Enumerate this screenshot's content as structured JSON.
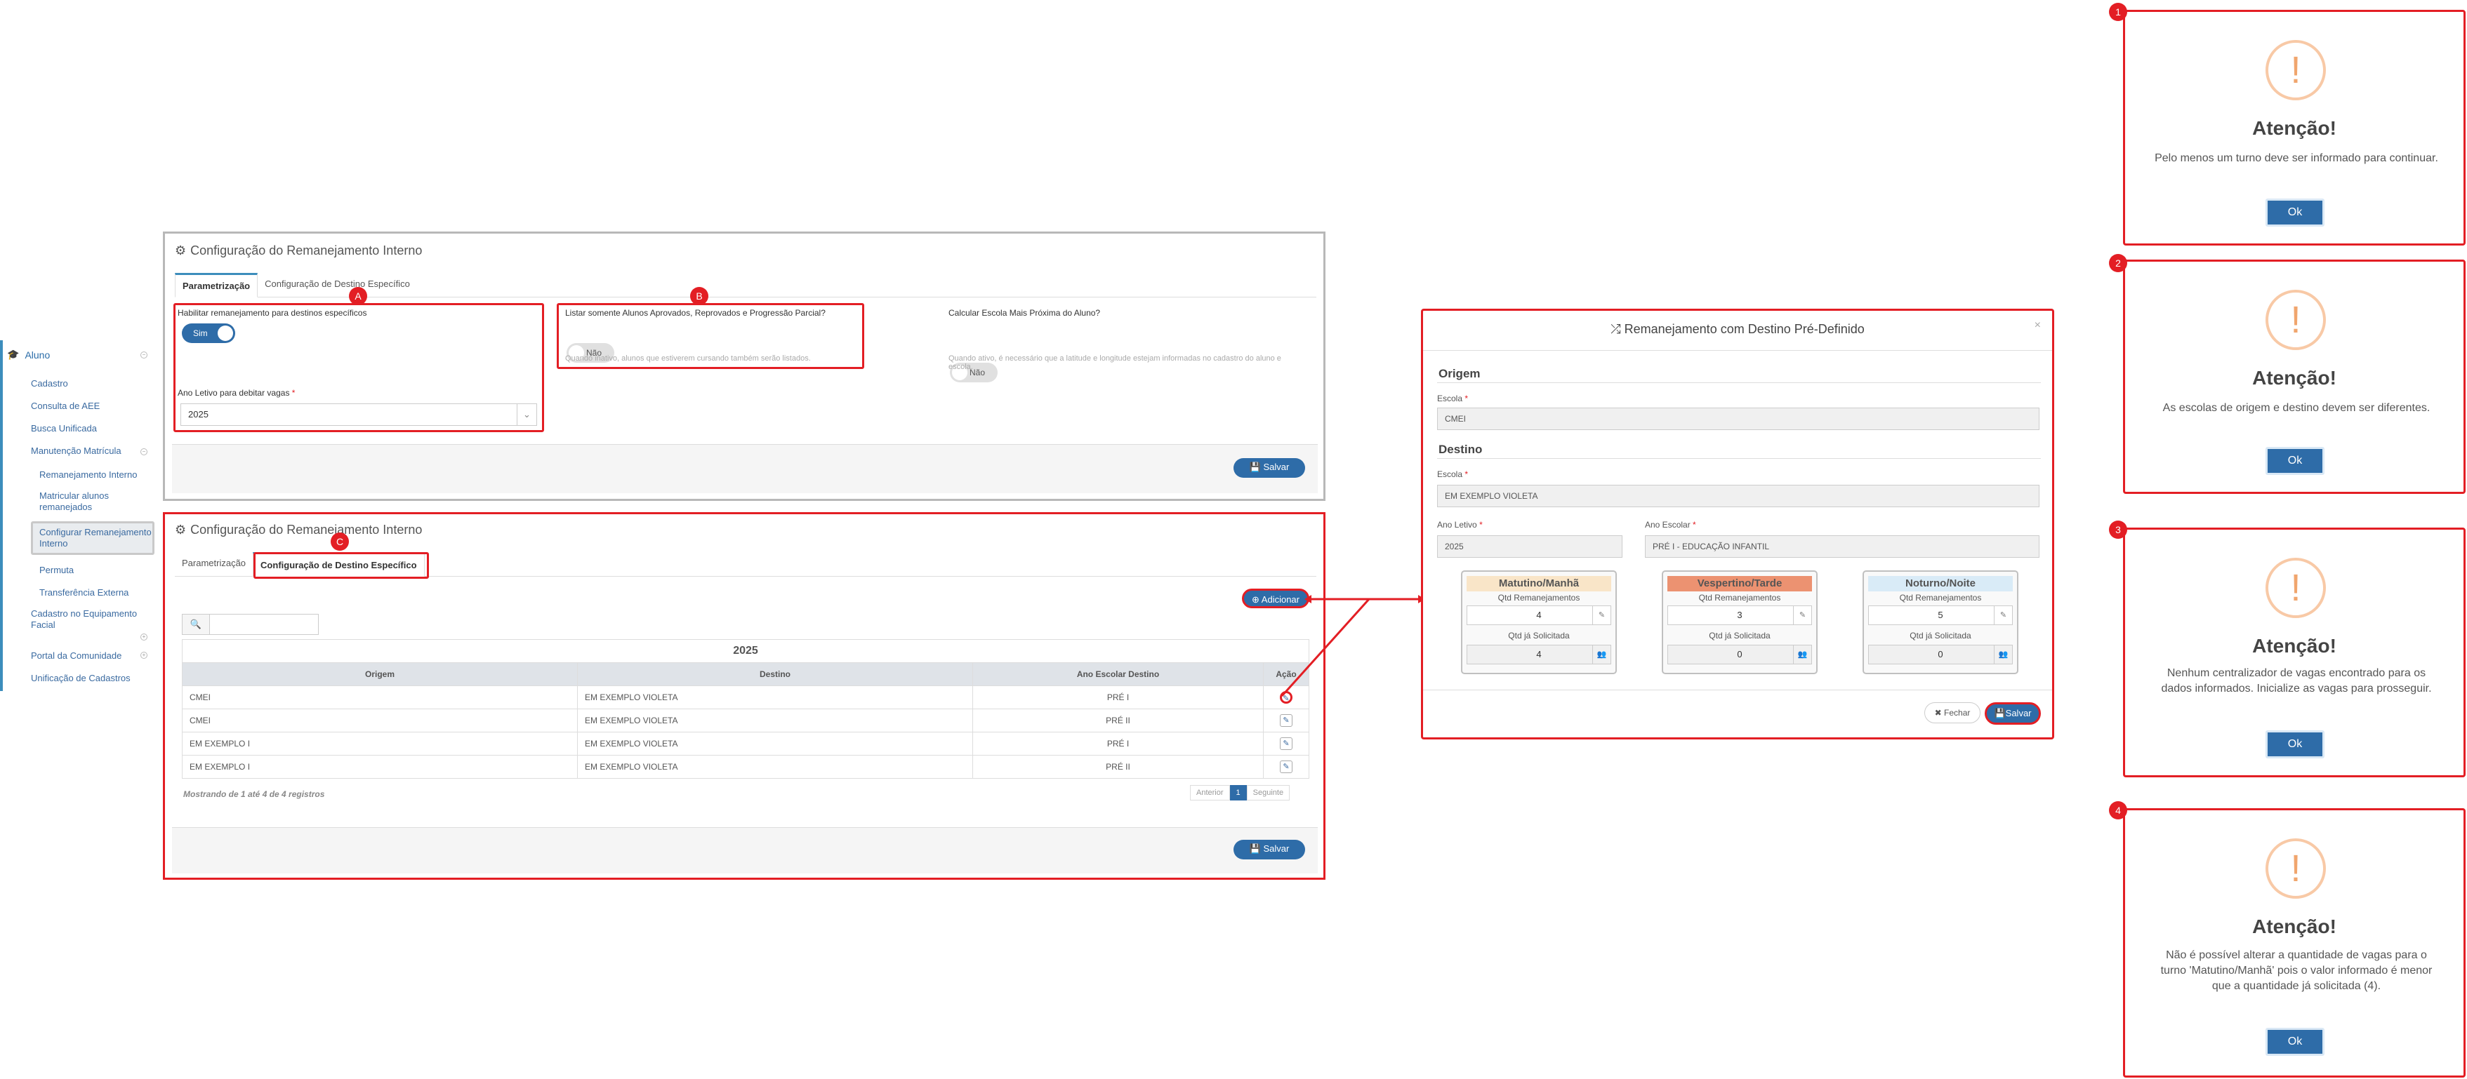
{
  "sidebar": {
    "header": "Aluno",
    "items": [
      "Cadastro",
      "Consulta de AEE",
      "Busca Unificada",
      "Manutenção Matrícula"
    ],
    "sub": [
      "Remanejamento Interno",
      "Matricular alunos remanejados",
      "Configurar Remanejamento Interno",
      "Permuta",
      "Transferência Externa"
    ],
    "items2": [
      "Cadastro no Equipamento Facial",
      "Portal da Comunidade",
      "Unificação de Cadastros"
    ]
  },
  "panel1": {
    "title": "Configuração do Remanejamento Interno",
    "tabs": [
      "Parametrização",
      "Configuração de Destino Específico"
    ],
    "habilitar_label": "Habilitar remanejamento para destinos específicos",
    "habilitar_value": "Sim",
    "ano_label": "Ano Letivo para debitar vagas",
    "ano_value": "2025",
    "listar_label": "Listar somente Alunos Aprovados, Reprovados e Progressão Parcial?",
    "listar_value": "Não",
    "listar_hint": "Quando inativo, alunos que estiverem cursando também serão listados.",
    "calc_label": "Calcular Escola Mais Próxima do Aluno?",
    "calc_value": "Não",
    "calc_hint": "Quando ativo, é necessário que a latitude e longitude estejam informadas no cadastro do aluno e escola.",
    "save": "Salvar"
  },
  "panel2": {
    "title": "Configuração do Remanejamento Interno",
    "tabs": [
      "Parametrização",
      "Configuração de Destino Específico"
    ],
    "add": "Adicionar",
    "year": "2025",
    "columns": [
      "Origem",
      "Destino",
      "Ano Escolar Destino",
      "Ação"
    ],
    "rows": [
      [
        "CMEI",
        "EM EXEMPLO VIOLETA",
        "PRÉ I"
      ],
      [
        "CMEI",
        "EM EXEMPLO VIOLETA",
        "PRÉ II"
      ],
      [
        "EM EXEMPLO I",
        "EM EXEMPLO VIOLETA",
        "PRÉ I"
      ],
      [
        "EM EXEMPLO I",
        "EM EXEMPLO VIOLETA",
        "PRÉ II"
      ]
    ],
    "info": "Mostrando de 1 até 4 de 4 registros",
    "prev": "Anterior",
    "page": "1",
    "next": "Seguinte",
    "save": "Salvar"
  },
  "markers": {
    "a": "A",
    "b": "B",
    "c": "C"
  },
  "modal": {
    "title": "Remanejamento com Destino Pré-Definido",
    "close": "×",
    "origem": "Origem",
    "escola_label": "Escola",
    "escola_origem": "CMEI",
    "destino": "Destino",
    "escola_destino": "EM EXEMPLO VIOLETA",
    "ano_letivo_label": "Ano Letivo",
    "ano_letivo": "2025",
    "ano_escolar_label": "Ano Escolar",
    "ano_escolar": "PRÉ I - EDUCAÇÃO INFANTIL",
    "qtd_label": "Qtd Remanejamentos",
    "sol_label": "Qtd já Solicitada",
    "turns": [
      {
        "name": "Matutino/Manhã",
        "qtd": "4",
        "sol": "4",
        "color": "#f9e5c8"
      },
      {
        "name": "Vespertino/Tarde",
        "qtd": "3",
        "sol": "0",
        "color": "#ec9271"
      },
      {
        "name": "Noturno/Noite",
        "qtd": "5",
        "sol": "0",
        "color": "#d9ebf7"
      }
    ],
    "fechar": "Fechar",
    "salvar": "Salvar"
  },
  "alerts": [
    {
      "num": "1",
      "icon": "!",
      "title": "Atenção!",
      "text": "Pelo menos um turno deve ser informado para continuar.",
      "ok": "Ok"
    },
    {
      "num": "2",
      "icon": "!",
      "title": "Atenção!",
      "text": "As escolas de origem e destino devem ser diferentes.",
      "ok": "Ok"
    },
    {
      "num": "3",
      "icon": "!",
      "title": "Atenção!",
      "text": "Nenhum centralizador de vagas encontrado para os dados informados. Inicialize as vagas para prosseguir.",
      "ok": "Ok"
    },
    {
      "num": "4",
      "icon": "!",
      "title": "Atenção!",
      "text": "Não é possível alterar a quantidade de vagas para o turno 'Matutino/Manhã' pois o valor informado é menor que a quantidade já solicitada (4).",
      "ok": "Ok"
    }
  ]
}
